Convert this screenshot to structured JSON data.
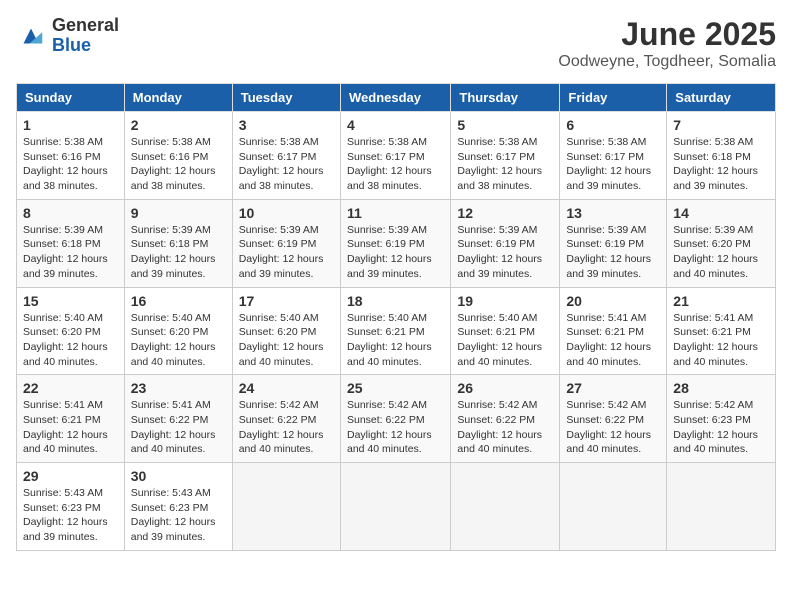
{
  "header": {
    "logo_general": "General",
    "logo_blue": "Blue",
    "month_title": "June 2025",
    "location": "Oodweyne, Togdheer, Somalia"
  },
  "days_of_week": [
    "Sunday",
    "Monday",
    "Tuesday",
    "Wednesday",
    "Thursday",
    "Friday",
    "Saturday"
  ],
  "weeks": [
    [
      {
        "day": "1",
        "sunrise": "Sunrise: 5:38 AM",
        "sunset": "Sunset: 6:16 PM",
        "daylight": "Daylight: 12 hours and 38 minutes."
      },
      {
        "day": "2",
        "sunrise": "Sunrise: 5:38 AM",
        "sunset": "Sunset: 6:16 PM",
        "daylight": "Daylight: 12 hours and 38 minutes."
      },
      {
        "day": "3",
        "sunrise": "Sunrise: 5:38 AM",
        "sunset": "Sunset: 6:17 PM",
        "daylight": "Daylight: 12 hours and 38 minutes."
      },
      {
        "day": "4",
        "sunrise": "Sunrise: 5:38 AM",
        "sunset": "Sunset: 6:17 PM",
        "daylight": "Daylight: 12 hours and 38 minutes."
      },
      {
        "day": "5",
        "sunrise": "Sunrise: 5:38 AM",
        "sunset": "Sunset: 6:17 PM",
        "daylight": "Daylight: 12 hours and 38 minutes."
      },
      {
        "day": "6",
        "sunrise": "Sunrise: 5:38 AM",
        "sunset": "Sunset: 6:17 PM",
        "daylight": "Daylight: 12 hours and 39 minutes."
      },
      {
        "day": "7",
        "sunrise": "Sunrise: 5:38 AM",
        "sunset": "Sunset: 6:18 PM",
        "daylight": "Daylight: 12 hours and 39 minutes."
      }
    ],
    [
      {
        "day": "8",
        "sunrise": "Sunrise: 5:39 AM",
        "sunset": "Sunset: 6:18 PM",
        "daylight": "Daylight: 12 hours and 39 minutes."
      },
      {
        "day": "9",
        "sunrise": "Sunrise: 5:39 AM",
        "sunset": "Sunset: 6:18 PM",
        "daylight": "Daylight: 12 hours and 39 minutes."
      },
      {
        "day": "10",
        "sunrise": "Sunrise: 5:39 AM",
        "sunset": "Sunset: 6:19 PM",
        "daylight": "Daylight: 12 hours and 39 minutes."
      },
      {
        "day": "11",
        "sunrise": "Sunrise: 5:39 AM",
        "sunset": "Sunset: 6:19 PM",
        "daylight": "Daylight: 12 hours and 39 minutes."
      },
      {
        "day": "12",
        "sunrise": "Sunrise: 5:39 AM",
        "sunset": "Sunset: 6:19 PM",
        "daylight": "Daylight: 12 hours and 39 minutes."
      },
      {
        "day": "13",
        "sunrise": "Sunrise: 5:39 AM",
        "sunset": "Sunset: 6:19 PM",
        "daylight": "Daylight: 12 hours and 39 minutes."
      },
      {
        "day": "14",
        "sunrise": "Sunrise: 5:39 AM",
        "sunset": "Sunset: 6:20 PM",
        "daylight": "Daylight: 12 hours and 40 minutes."
      }
    ],
    [
      {
        "day": "15",
        "sunrise": "Sunrise: 5:40 AM",
        "sunset": "Sunset: 6:20 PM",
        "daylight": "Daylight: 12 hours and 40 minutes."
      },
      {
        "day": "16",
        "sunrise": "Sunrise: 5:40 AM",
        "sunset": "Sunset: 6:20 PM",
        "daylight": "Daylight: 12 hours and 40 minutes."
      },
      {
        "day": "17",
        "sunrise": "Sunrise: 5:40 AM",
        "sunset": "Sunset: 6:20 PM",
        "daylight": "Daylight: 12 hours and 40 minutes."
      },
      {
        "day": "18",
        "sunrise": "Sunrise: 5:40 AM",
        "sunset": "Sunset: 6:21 PM",
        "daylight": "Daylight: 12 hours and 40 minutes."
      },
      {
        "day": "19",
        "sunrise": "Sunrise: 5:40 AM",
        "sunset": "Sunset: 6:21 PM",
        "daylight": "Daylight: 12 hours and 40 minutes."
      },
      {
        "day": "20",
        "sunrise": "Sunrise: 5:41 AM",
        "sunset": "Sunset: 6:21 PM",
        "daylight": "Daylight: 12 hours and 40 minutes."
      },
      {
        "day": "21",
        "sunrise": "Sunrise: 5:41 AM",
        "sunset": "Sunset: 6:21 PM",
        "daylight": "Daylight: 12 hours and 40 minutes."
      }
    ],
    [
      {
        "day": "22",
        "sunrise": "Sunrise: 5:41 AM",
        "sunset": "Sunset: 6:21 PM",
        "daylight": "Daylight: 12 hours and 40 minutes."
      },
      {
        "day": "23",
        "sunrise": "Sunrise: 5:41 AM",
        "sunset": "Sunset: 6:22 PM",
        "daylight": "Daylight: 12 hours and 40 minutes."
      },
      {
        "day": "24",
        "sunrise": "Sunrise: 5:42 AM",
        "sunset": "Sunset: 6:22 PM",
        "daylight": "Daylight: 12 hours and 40 minutes."
      },
      {
        "day": "25",
        "sunrise": "Sunrise: 5:42 AM",
        "sunset": "Sunset: 6:22 PM",
        "daylight": "Daylight: 12 hours and 40 minutes."
      },
      {
        "day": "26",
        "sunrise": "Sunrise: 5:42 AM",
        "sunset": "Sunset: 6:22 PM",
        "daylight": "Daylight: 12 hours and 40 minutes."
      },
      {
        "day": "27",
        "sunrise": "Sunrise: 5:42 AM",
        "sunset": "Sunset: 6:22 PM",
        "daylight": "Daylight: 12 hours and 40 minutes."
      },
      {
        "day": "28",
        "sunrise": "Sunrise: 5:42 AM",
        "sunset": "Sunset: 6:23 PM",
        "daylight": "Daylight: 12 hours and 40 minutes."
      }
    ],
    [
      {
        "day": "29",
        "sunrise": "Sunrise: 5:43 AM",
        "sunset": "Sunset: 6:23 PM",
        "daylight": "Daylight: 12 hours and 39 minutes."
      },
      {
        "day": "30",
        "sunrise": "Sunrise: 5:43 AM",
        "sunset": "Sunset: 6:23 PM",
        "daylight": "Daylight: 12 hours and 39 minutes."
      },
      null,
      null,
      null,
      null,
      null
    ]
  ]
}
